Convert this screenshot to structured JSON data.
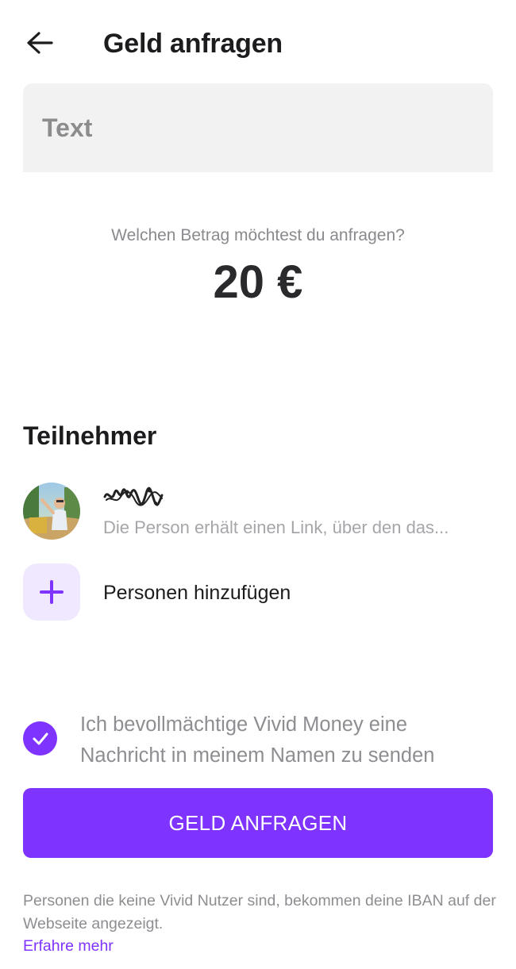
{
  "header": {
    "title": "Geld anfragen",
    "back_icon": "arrow-left-icon"
  },
  "text_field": {
    "placeholder": "Text",
    "value": ""
  },
  "amount": {
    "question": "Welchen Betrag möchtest du anfragen?",
    "value": "20 €"
  },
  "participants": {
    "title": "Teilnehmer",
    "items": [
      {
        "avatar_icon": "user-avatar-photo",
        "name_icon": "scribbled-name-icon",
        "subtitle": "Die Person erhält einen Link, über den das..."
      }
    ],
    "add_label": "Personen hinzufügen",
    "add_icon": "plus-icon"
  },
  "consent": {
    "checked": true,
    "check_icon": "checkmark-icon",
    "text": "Ich bevollmächtige Vivid Money eine Nachricht in meinem Namen zu senden"
  },
  "cta": {
    "label": "GELD ANFRAGEN"
  },
  "footer": {
    "note": "Personen die keine Vivid Nutzer sind, bekommen deine IBAN auf der Webseite angezeigt.",
    "link": "Erfahre mehr"
  },
  "colors": {
    "accent": "#7f33ff",
    "accent_light": "#f0e8ff",
    "field_bg": "#f2f2f2",
    "text_primary": "#1c1c1e",
    "text_secondary": "#8e8e92"
  }
}
